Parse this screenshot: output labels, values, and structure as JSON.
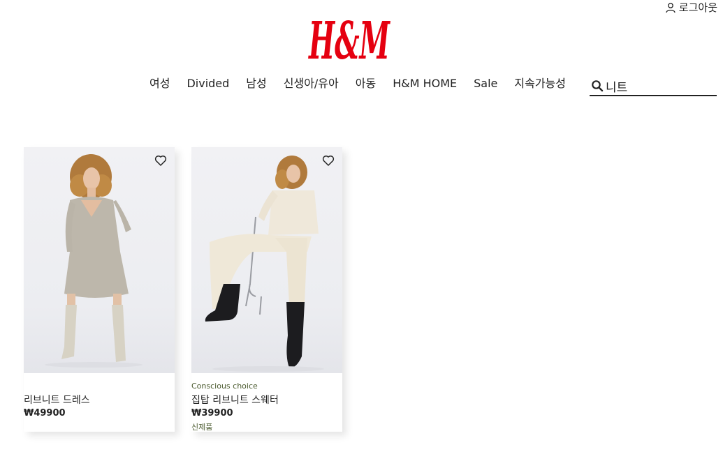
{
  "header": {
    "account_label": "로그아웃",
    "brand": "H&M",
    "brand_color": "#e50010"
  },
  "nav": {
    "items": [
      {
        "label": "여성"
      },
      {
        "label": "Divided"
      },
      {
        "label": "남성"
      },
      {
        "label": "신생아/유아"
      },
      {
        "label": "아동"
      },
      {
        "label": "H&M HOME"
      },
      {
        "label": "Sale"
      },
      {
        "label": "지속가능성"
      }
    ]
  },
  "search": {
    "value": "니트",
    "icon": "search-icon"
  },
  "products": [
    {
      "tag": "",
      "name": "리브니트 드레스",
      "price": "₩49900",
      "badge": "",
      "favorite_icon": "heart-icon"
    },
    {
      "tag": "Conscious choice",
      "name": "집탑 리브니트 스웨터",
      "price": "₩39900",
      "badge": "신제품",
      "favorite_icon": "heart-icon"
    }
  ]
}
